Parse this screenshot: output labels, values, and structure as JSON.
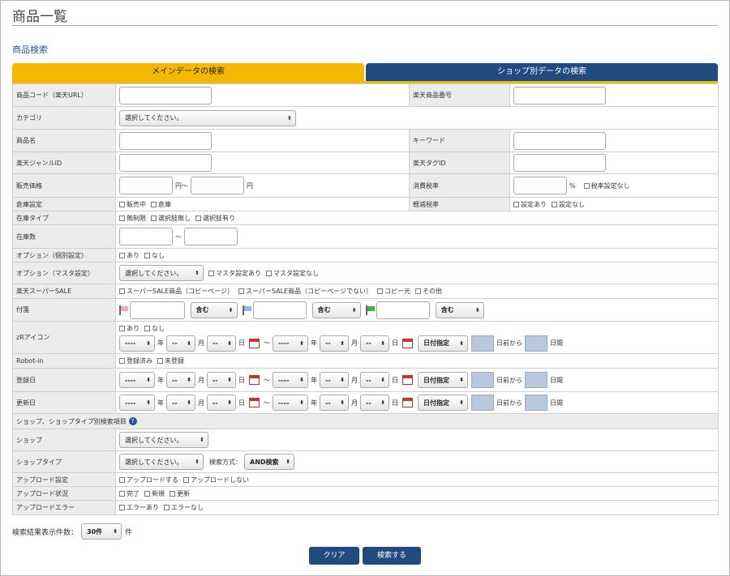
{
  "page": {
    "title": "商品一覧",
    "section_title": "商品検索"
  },
  "tabs": {
    "main": "メインデータの検索",
    "shop": "ショップ別データの検索"
  },
  "labels": {
    "product_code": "商品コード（楽天URL）",
    "rakuten_product_no": "楽天商品番号",
    "category": "カテゴリ",
    "product_name": "商品名",
    "keyword": "キーワード",
    "genre_id": "楽天ジャンルID",
    "tag_id": "楽天タグID",
    "price": "販売価格",
    "tax_rate": "消費税率",
    "warehouse": "倉庫設定",
    "reduced_tax": "軽減税率",
    "stock_type": "在庫タイプ",
    "stock_qty": "在庫数",
    "option_individual": "オプション（個別設定）",
    "option_master": "オプション（マスタ設定）",
    "super_sale": "楽天スーパーSALE",
    "sticky": "付箋",
    "zr_icon": "zRアイコン",
    "robot_in": "Robot-in",
    "registered": "登録日",
    "updated": "更新日",
    "shop_section": "ショップ、ショップタイプ別検索項目",
    "shop": "ショップ",
    "shop_type": "ショップタイプ",
    "upload_setting": "アップロード設定",
    "upload_status": "アップロード状況",
    "upload_error": "アップロードエラー"
  },
  "select_placeholder": "選択してください。",
  "units": {
    "yen_tilde": "円～",
    "yen": "円",
    "percent": "%",
    "tilde": "～",
    "year": "年",
    "month": "月",
    "day": "日",
    "days_before": "日前から",
    "days_span": "日間"
  },
  "options": {
    "tax_no_setting": "税率設定なし",
    "warehouse": [
      "販売中",
      "倉庫"
    ],
    "reduced_tax": [
      "設定あり",
      "設定なし"
    ],
    "stock_type": [
      "無制限",
      "選択肢無し",
      "選択肢有り"
    ],
    "option_individual": [
      "あり",
      "なし"
    ],
    "option_master": [
      "マスタ設定あり",
      "マスタ設定なし"
    ],
    "super_sale": [
      "スーパーSALE商品（コピーページ）",
      "スーパーSALE商品（コピーページでない）",
      "コピー元",
      "その他"
    ],
    "zr_icon": [
      "あり",
      "なし"
    ],
    "robot_in": [
      "登録済み",
      "未登録"
    ],
    "upload_setting": [
      "アップロードする",
      "アップロードしない"
    ],
    "upload_status": [
      "完了",
      "新規",
      "更新"
    ],
    "upload_error": [
      "エラーあり",
      "エラーなし"
    ]
  },
  "selects": {
    "contains": "含む",
    "date_blank_year": "----",
    "date_blank": "--",
    "date_mode": "日付指定",
    "search_method_label": "検索方式：",
    "search_method": "AND検索"
  },
  "sticky_colors": [
    "#f2a3c9",
    "#8ab8ea",
    "#3fae4a"
  ],
  "footer": {
    "result_count_label": "検索結果表示件数：",
    "result_count": "30件",
    "result_unit": "件",
    "clear": "クリア",
    "search": "検索する"
  },
  "colors": {
    "tab_main": "#f5b800",
    "tab_shop": "#1f4b7e",
    "button": "#1f4b7e"
  }
}
